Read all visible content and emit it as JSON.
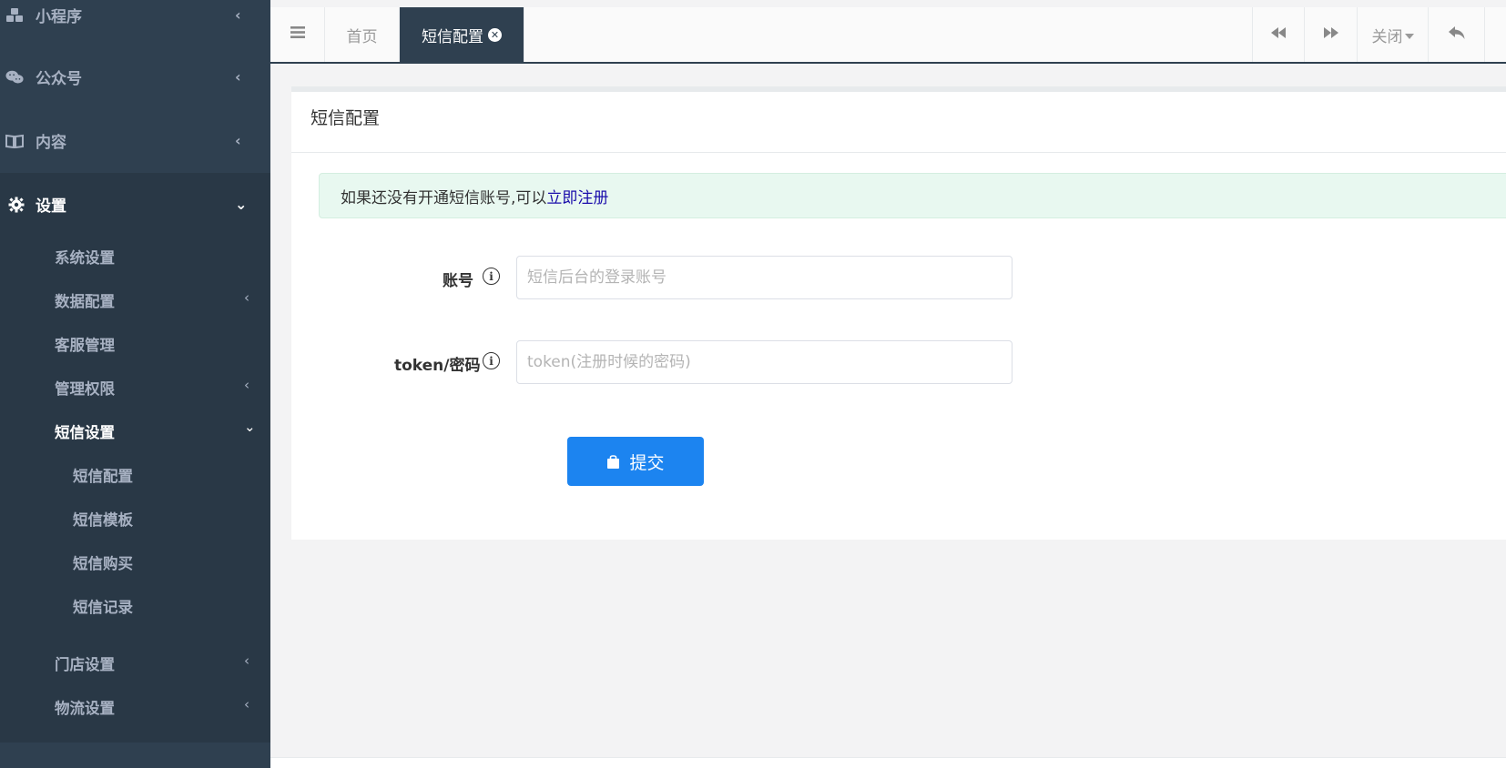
{
  "sidebar": {
    "top_items": [
      {
        "label": "小程序",
        "icon": "cubes-icon"
      },
      {
        "label": "公众号",
        "icon": "wechat-icon"
      },
      {
        "label": "内容",
        "icon": "book-icon"
      },
      {
        "label": "设置",
        "icon": "gear-icon"
      }
    ],
    "settings_children": [
      {
        "label": "系统设置"
      },
      {
        "label": "数据配置"
      },
      {
        "label": "客服管理"
      },
      {
        "label": "管理权限"
      },
      {
        "label": "短信设置"
      }
    ],
    "sms_children": [
      {
        "label": "短信配置"
      },
      {
        "label": "短信模板"
      },
      {
        "label": "短信购买"
      },
      {
        "label": "短信记录"
      }
    ],
    "more_children": [
      {
        "label": "门店设置"
      },
      {
        "label": "物流设置"
      }
    ]
  },
  "topbar": {
    "tabs": [
      {
        "label": "首页"
      },
      {
        "label": "短信配置"
      }
    ],
    "close_menu_label": "关闭"
  },
  "panel": {
    "title": "短信配置",
    "alert_text": "如果还没有开通短信账号,可以",
    "alert_link": "立即注册",
    "fields": [
      {
        "label": "账号",
        "placeholder": "短信后台的登录账号",
        "value": ""
      },
      {
        "label": "token/密码",
        "placeholder": "token(注册时候的密码)",
        "value": ""
      }
    ],
    "submit_label": "提交"
  },
  "colors": {
    "sidebar_bg": "#2f4050",
    "sidebar_active_bg": "#293846",
    "primary_button": "#1c84f0",
    "alert_bg": "#e8f8f0",
    "link": "#1a0dab"
  }
}
